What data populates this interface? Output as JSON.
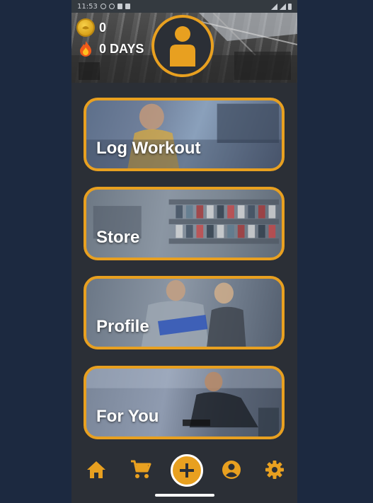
{
  "status_bar": {
    "time": "11:53"
  },
  "header": {
    "coins": "0",
    "streak": "0 DAYS"
  },
  "cards": [
    {
      "label": "Log Workout"
    },
    {
      "label": "Store"
    },
    {
      "label": "Profile"
    },
    {
      "label": "For You"
    }
  ],
  "nav": {
    "items": [
      "home-icon",
      "cart-icon",
      "add-icon",
      "account-icon",
      "settings-icon"
    ]
  },
  "colors": {
    "accent": "#e8a020",
    "surface": "#2b2f36",
    "page_bg": "#1c2940"
  }
}
